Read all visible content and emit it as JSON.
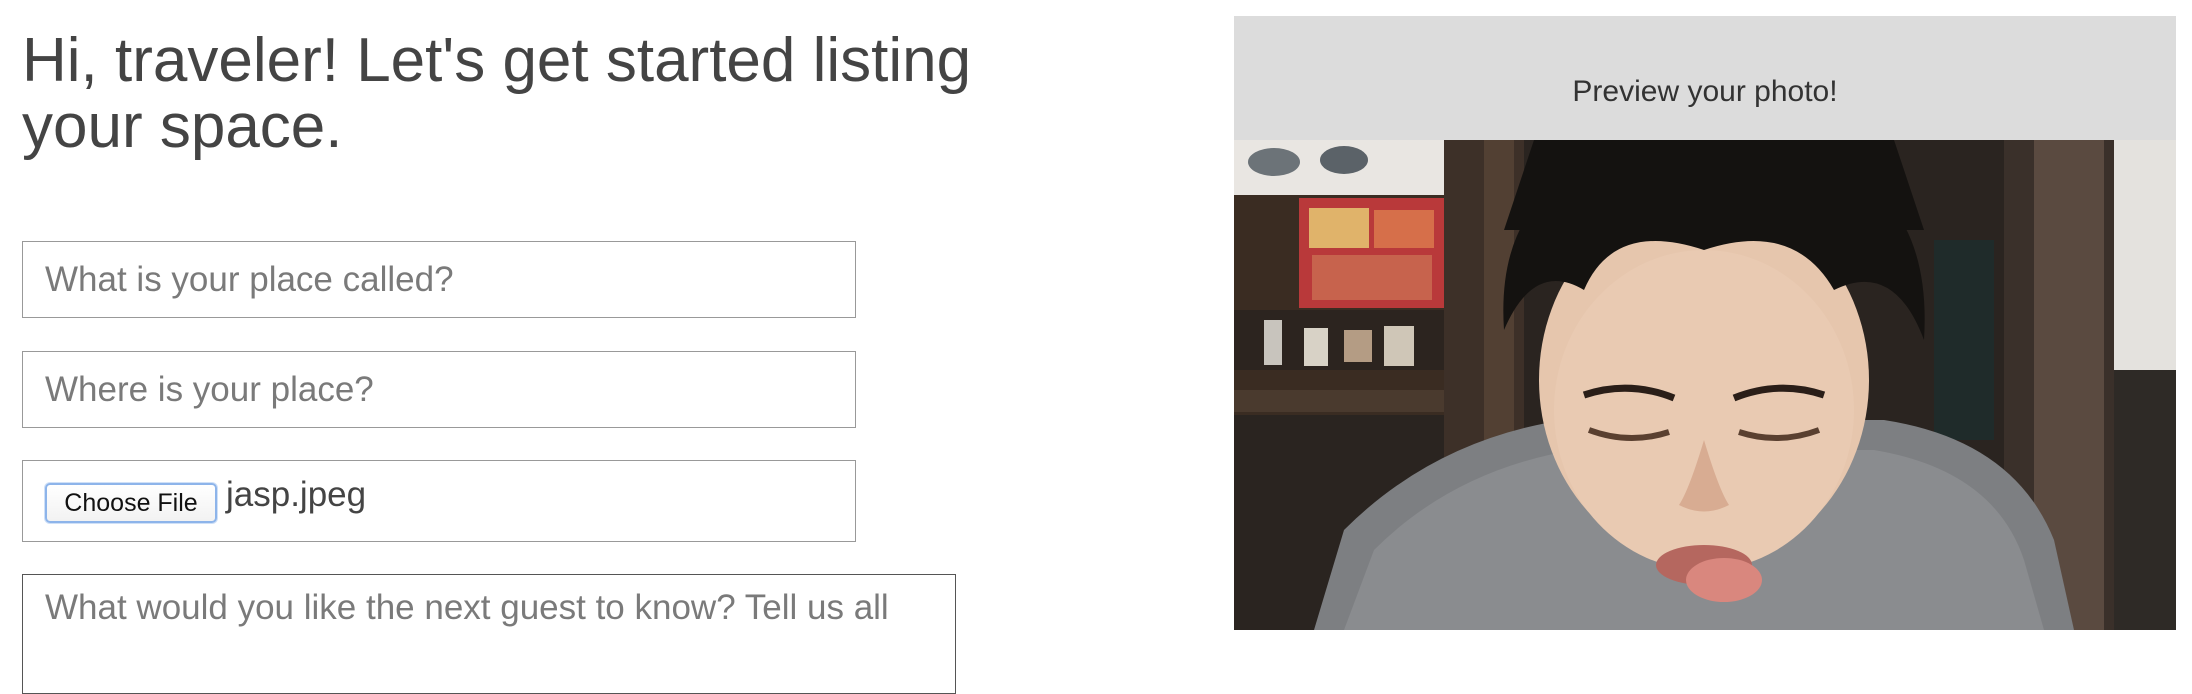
{
  "header": {
    "title": "Hi, traveler! Let's get started listing your space."
  },
  "form": {
    "name_placeholder": "What is your place called?",
    "location_placeholder": "Where is your place?",
    "file_button_label": "Choose File",
    "file_name": "jasp.jpeg",
    "description_placeholder": "What would you like the next guest to know? Tell us all"
  },
  "preview": {
    "label": "Preview your photo!",
    "image_subject": "photo of a person at a restaurant"
  }
}
